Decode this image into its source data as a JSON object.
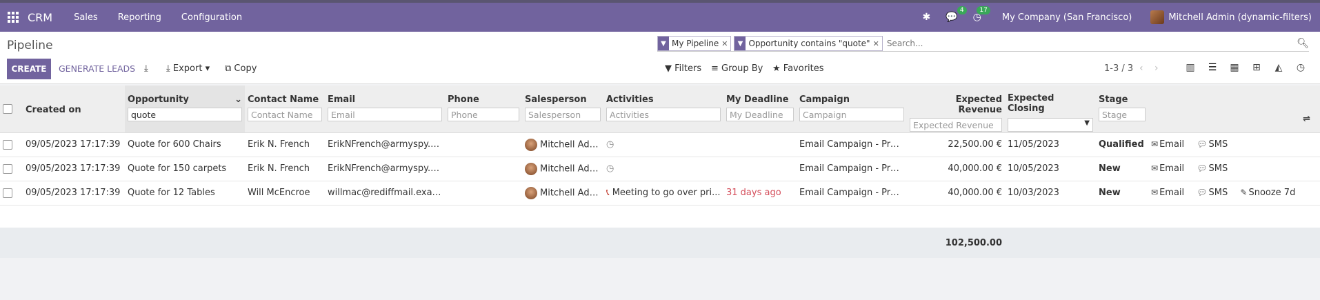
{
  "topbar": {
    "app": "CRM",
    "menus": [
      "Sales",
      "Reporting",
      "Configuration"
    ],
    "messages_badge": "4",
    "activities_badge": "17",
    "company": "My Company (San Francisco)",
    "user": "Mitchell Admin (dynamic-filters)"
  },
  "control": {
    "title": "Pipeline",
    "facets": [
      "My Pipeline",
      "Opportunity contains \"quote\""
    ],
    "search_placeholder": "Search...",
    "create": "CREATE",
    "generate_leads": "GENERATE LEADS",
    "export": "Export",
    "copy": "Copy",
    "filters": "Filters",
    "group_by": "Group By",
    "favorites": "Favorites",
    "pager": "1-3 / 3"
  },
  "columns": {
    "created_on": "Created on",
    "opportunity": "Opportunity",
    "opportunity_filter": "quote",
    "contact": "Contact Name",
    "email": "Email",
    "phone": "Phone",
    "salesperson": "Salesperson",
    "activities": "Activities",
    "deadline": "My Deadline",
    "campaign": "Campaign",
    "revenue": "Expected Revenue",
    "closing": "Expected Closing",
    "stage": "Stage"
  },
  "rows": [
    {
      "created": "09/05/2023 17:17:39",
      "opportunity": "Quote for 600 Chairs",
      "contact": "Erik N. French",
      "email": "ErikNFrench@armyspy.com",
      "phone": "",
      "salesperson": "Mitchell Admin",
      "activity": "",
      "deadline": "",
      "campaign": "Email Campaign - Products",
      "revenue": "22,500.00 €",
      "closing": "11/05/2023",
      "stage": "Qualified"
    },
    {
      "created": "09/05/2023 17:17:39",
      "opportunity": "Quote for 150 carpets",
      "contact": "Erik N. French",
      "email": "ErikNFrench@armyspy.com",
      "phone": "",
      "salesperson": "Mitchell Admin",
      "activity": "",
      "deadline": "",
      "campaign": "Email Campaign - Products",
      "revenue": "40,000.00 €",
      "closing": "10/05/2023",
      "stage": "New"
    },
    {
      "created": "09/05/2023 17:17:39",
      "opportunity": "Quote for 12 Tables",
      "contact": "Will McEncroe",
      "email": "willmac@rediffmail.exampl...",
      "phone": "",
      "salesperson": "Mitchell Admin",
      "activity": "Meeting to go over pri...",
      "deadline": "31 days ago",
      "campaign": "Email Campaign - Products",
      "revenue": "40,000.00 €",
      "closing": "10/03/2023",
      "stage": "New"
    }
  ],
  "row_actions": {
    "email": "Email",
    "sms": "SMS",
    "snooze": "Snooze 7d"
  },
  "total_revenue": "102,500.00"
}
